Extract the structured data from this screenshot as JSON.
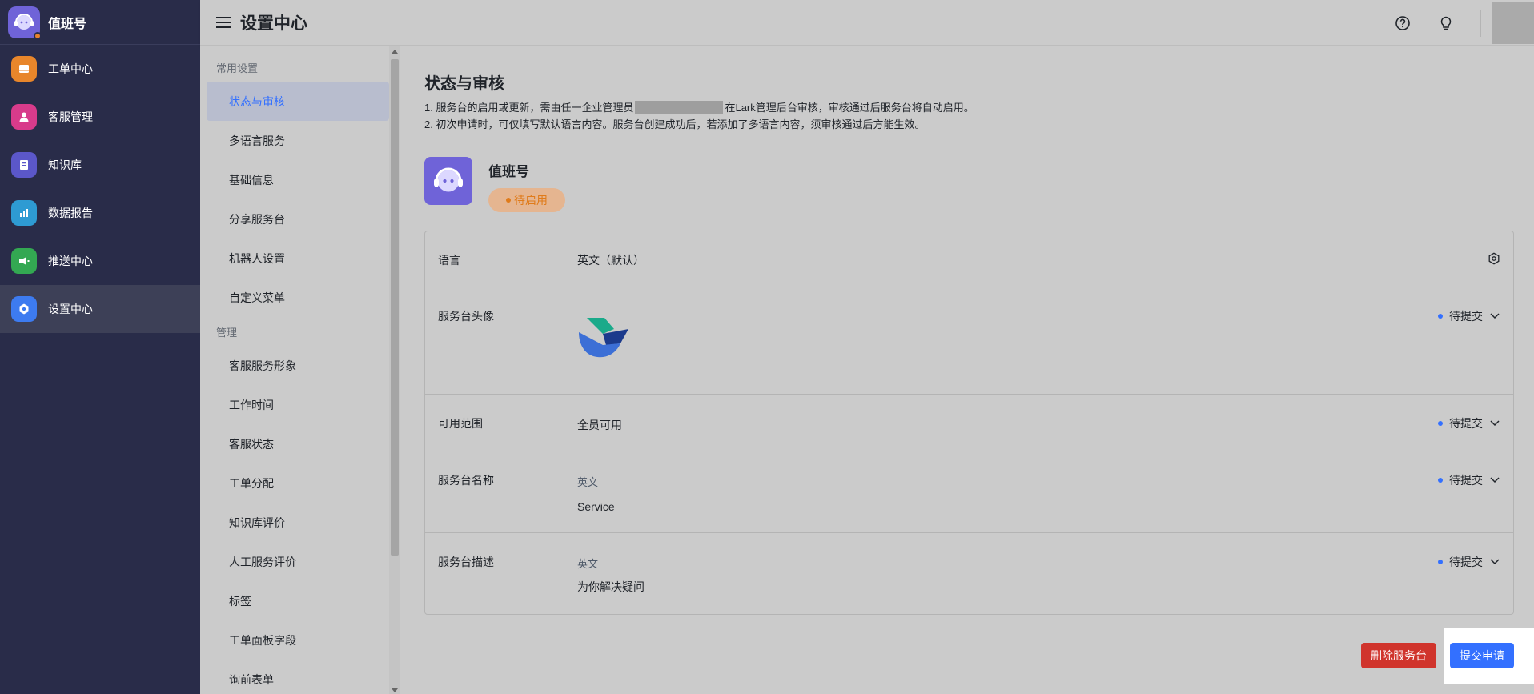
{
  "app": {
    "name": "值班号",
    "nav": [
      {
        "label": "工单中心",
        "icon": "inbox-icon",
        "color": "#e8862b"
      },
      {
        "label": "客服管理",
        "icon": "user-icon",
        "color": "#d83b8b"
      },
      {
        "label": "知识库",
        "icon": "book-icon",
        "color": "#5b57c9"
      },
      {
        "label": "数据报告",
        "icon": "bar-chart-icon",
        "color": "#2e9bd3"
      },
      {
        "label": "推送中心",
        "icon": "megaphone-icon",
        "color": "#33a852"
      },
      {
        "label": "设置中心",
        "icon": "settings-icon",
        "color": "#3d7bf0"
      }
    ]
  },
  "header": {
    "title": "设置中心",
    "icons": [
      "help-icon",
      "lightbulb-icon"
    ]
  },
  "settings_nav": {
    "group1_label": "常用设置",
    "group1": [
      "状态与审核",
      "多语言服务",
      "基础信息",
      "分享服务台",
      "机器人设置",
      "自定义菜单"
    ],
    "group2_label": "管理",
    "group2": [
      "客服服务形象",
      "工作时间",
      "客服状态",
      "工单分配",
      "知识库评价",
      "人工服务评价",
      "标签",
      "工单面板字段",
      "询前表单"
    ]
  },
  "main": {
    "title": "状态与审核",
    "note1_pre": "1. 服务台的启用或更新，需由任一企业管理员",
    "note1_post": "在Lark管理后台审核，审核通过后服务台将自动启用。",
    "note2": "2. 初次申请时，可仅填写默认语言内容。服务台创建成功后，若添加了多语言内容，须审核通过后方能生效。",
    "desk_name": "值班号",
    "badge": "待启用",
    "rows": {
      "language": {
        "label": "语言",
        "value": "英文（默认）"
      },
      "avatar": {
        "label": "服务台头像",
        "status": "待提交"
      },
      "scope": {
        "label": "可用范围",
        "value": "全员可用",
        "status": "待提交"
      },
      "name": {
        "label": "服务台名称",
        "sub": "英文",
        "value": "Service",
        "status": "待提交"
      },
      "desc": {
        "label": "服务台描述",
        "sub": "英文",
        "value": "为你解决疑问",
        "status": "待提交"
      }
    },
    "delete_label": "删除服务台",
    "submit_label": "提交申请"
  }
}
